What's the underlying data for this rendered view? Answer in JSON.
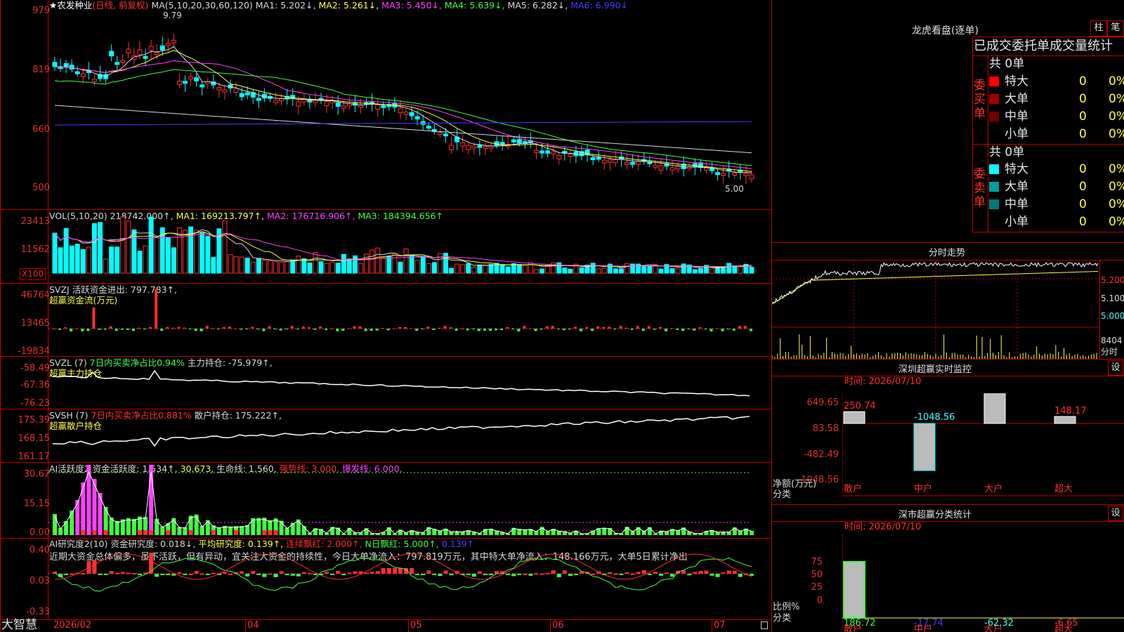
{
  "stock": {
    "name": "★农发种业",
    "mode": "(日线, 前复权)",
    "ma_line": [
      {
        "label": "MA(5,10,20,30,60,120)",
        "color": "#d8d8d8"
      },
      {
        "label": "MA1: 5.202↓,",
        "color": "#d8d8d8"
      },
      {
        "label": "MA2: 5.261↓,",
        "color": "#ffff40"
      },
      {
        "label": "MA3: 5.450↓,",
        "color": "#ff40ff"
      },
      {
        "label": "MA4: 5.639↓,",
        "color": "#40ff40"
      },
      {
        "label": "MA5: 6.282↓,",
        "color": "#d8d8d8"
      },
      {
        "label": "MA6: 6.990↓",
        "color": "#4040ff"
      }
    ],
    "high_label": "9.79",
    "low_label": "5.00",
    "price_axis": [
      "979",
      "819",
      "660",
      "500"
    ]
  },
  "vol": {
    "line": [
      {
        "label": "VOL(5,10,20)",
        "color": "#d8d8d8"
      },
      {
        "label": "218742.000↑,",
        "color": "#d8d8d8"
      },
      {
        "label": "MA1: 169213.797↑,",
        "color": "#ffff40"
      },
      {
        "label": "MA2: 176716.906↑,",
        "color": "#ff40ff"
      },
      {
        "label": "MA3: 184394.656↑",
        "color": "#40ff40"
      }
    ],
    "axis": [
      "23413",
      "11562"
    ],
    "unit": "X100"
  },
  "svzj": {
    "line1": [
      {
        "label": "SVZJ  活跃资金进出: 797.783↑,",
        "color": "#d8d8d8"
      }
    ],
    "line2": "超赢资金流(万元)",
    "axis": [
      "46764",
      "13465",
      "-19834"
    ]
  },
  "svzl": {
    "line1": [
      {
        "label": "SVZL (7)",
        "color": "#d8d8d8"
      },
      {
        "label": "7日内买卖净占比0.94%",
        "color": "#40ff40"
      },
      {
        "label": "主力持仓: -75.979↑,",
        "color": "#d8d8d8"
      }
    ],
    "line2": "超赢主力持仓",
    "axis": [
      "-58.49",
      "-67.36",
      "-76.23"
    ]
  },
  "svsh": {
    "line1": [
      {
        "label": "SVSH (7)",
        "color": "#d8d8d8"
      },
      {
        "label": "7日内买卖净占比0.881%",
        "color": "#ff3030"
      },
      {
        "label": "散户持仓: 175.222↑,",
        "color": "#d8d8d8"
      }
    ],
    "line2": "超赢散户持仓",
    "axis": [
      "175.39",
      "168.15",
      "161.17"
    ]
  },
  "ai_active": {
    "line1": [
      {
        "label": "AI活跃度2",
        "color": "#d8d8d8"
      },
      {
        "label": "资金活跃度: 1.534↑,",
        "color": "#d8d8d8"
      },
      {
        "label": "30.673,",
        "color": "#ffff40"
      },
      {
        "label": "生命线: 1.560,",
        "color": "#d8d8d8"
      },
      {
        "label": "强势线: 3.000,",
        "color": "#ff3030"
      },
      {
        "label": "爆发线: 6.000,",
        "color": "#ff40ff"
      }
    ],
    "axis": [
      "30.67",
      "15.15",
      "0.00"
    ]
  },
  "ai_research": {
    "line1": [
      {
        "label": "AI研究度2(10)",
        "color": "#d8d8d8"
      },
      {
        "label": "资金研究度: 0.018↓,",
        "color": "#d8d8d8"
      },
      {
        "label": "平均研究度: 0.139↑,",
        "color": "#ffff40"
      },
      {
        "label": "连续飘红: 2.000↑,",
        "color": "#ff3030"
      },
      {
        "label": "N日飘红: 5.000↑,",
        "color": "#40ff40"
      },
      {
        "label": "0.139↑",
        "color": "#4040ff"
      }
    ],
    "line2": "近期大资金总体偏多，虽不活跃，但有异动，宜关注大资金的持续性，今日大单净流入：797.819万元，其中特大单净流入：148.166万元，大单5日累计净出",
    "axis": [
      "0.40",
      "0.03",
      "-0.33"
    ]
  },
  "date_axis": [
    "2026/02",
    "04",
    "05",
    "06",
    "07"
  ],
  "brand": "大智慧",
  "right": {
    "dragon_title": "龙虎看盘(逐单)",
    "btn1": "柱",
    "btn2": "笔",
    "table_title": "已成交委托单成交量统计",
    "buy_group": "委买单",
    "sell_group": "委卖单",
    "buy_total": "共 0单",
    "sell_total": "共 0单",
    "buy_rows": [
      {
        "label": "特大",
        "count": "0",
        "pct": "0%",
        "color": "#ff0000"
      },
      {
        "label": "大单",
        "count": "0",
        "pct": "0%",
        "color": "#a00000"
      },
      {
        "label": "中单",
        "count": "0",
        "pct": "0%",
        "color": "#700000"
      },
      {
        "label": "小单",
        "count": "0",
        "pct": "0%",
        "color": "#000000"
      }
    ],
    "sell_rows": [
      {
        "label": "特大",
        "count": "0",
        "pct": "0%",
        "color": "#00ffff"
      },
      {
        "label": "大单",
        "count": "0",
        "pct": "0%",
        "color": "#00a0a0"
      },
      {
        "label": "中单",
        "count": "0",
        "pct": "0%",
        "color": "#007878"
      },
      {
        "label": "小单",
        "count": "0",
        "pct": "0%",
        "color": "#000000"
      }
    ],
    "intraday_title": "分时走势",
    "intraday_axis": [
      "5.200",
      "5.100",
      "5.000"
    ],
    "intraday_vol": "8404",
    "intraday_vol_label": "分时",
    "monitor_title": "深圳超赢实时监控",
    "monitor_btn": "设",
    "monitor_time": "时间: 2026/07/10",
    "monitor_axis": [
      "649.65",
      "83.58",
      "-482.49",
      "-1048.56"
    ],
    "monitor_ylabel": "净额(万元)",
    "monitor_xlabel": "分类",
    "monitor_values": [
      "250.74",
      "-1048.56",
      "649.65",
      "148.17"
    ],
    "categories": [
      "散户",
      "中户",
      "大户",
      "超大"
    ],
    "stats_title": "深市超赢分类统计",
    "stats_btn": "设",
    "stats_time": "时间: 2026/07/10",
    "stats_axis": [
      "75",
      "50",
      "25",
      "0"
    ],
    "stats_ylabel": "比例%",
    "stats_xlabel": "分类",
    "stats_values": [
      "186.72",
      "-17.74",
      "-62.32",
      "-6.65"
    ]
  }
}
